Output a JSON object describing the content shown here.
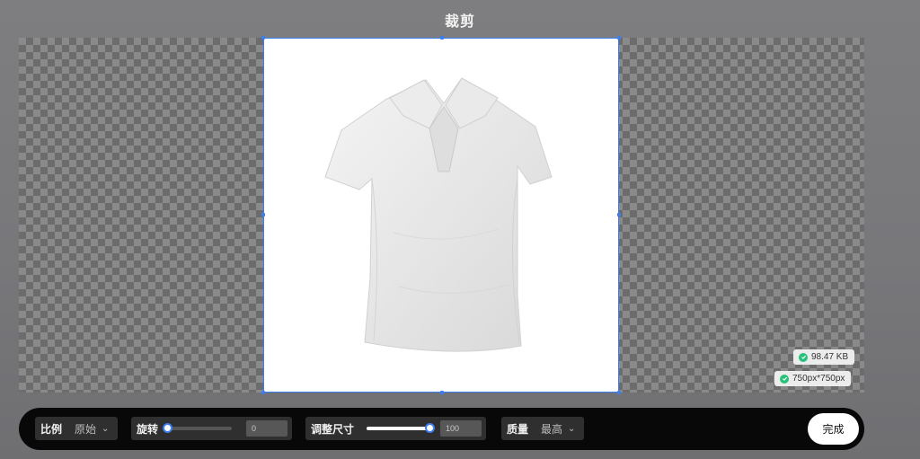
{
  "header": {
    "title": "裁剪"
  },
  "badges": {
    "file_size": "98.47 KB",
    "dimensions": "750px*750px"
  },
  "toolbar": {
    "ratio": {
      "label": "比例",
      "value": "原始"
    },
    "rotate": {
      "label": "旋转",
      "value": "0",
      "level": 0
    },
    "resize": {
      "label": "调整尺寸",
      "value": "100",
      "level": 1.0
    },
    "quality": {
      "label": "质量",
      "value": "最高"
    },
    "done_label": "完成"
  },
  "colors": {
    "accent": "#3c7ef0",
    "success": "#27c27a",
    "toolbar_bg": "#080808"
  },
  "icons": [
    "chevron-down-icon",
    "check-circle-icon"
  ]
}
